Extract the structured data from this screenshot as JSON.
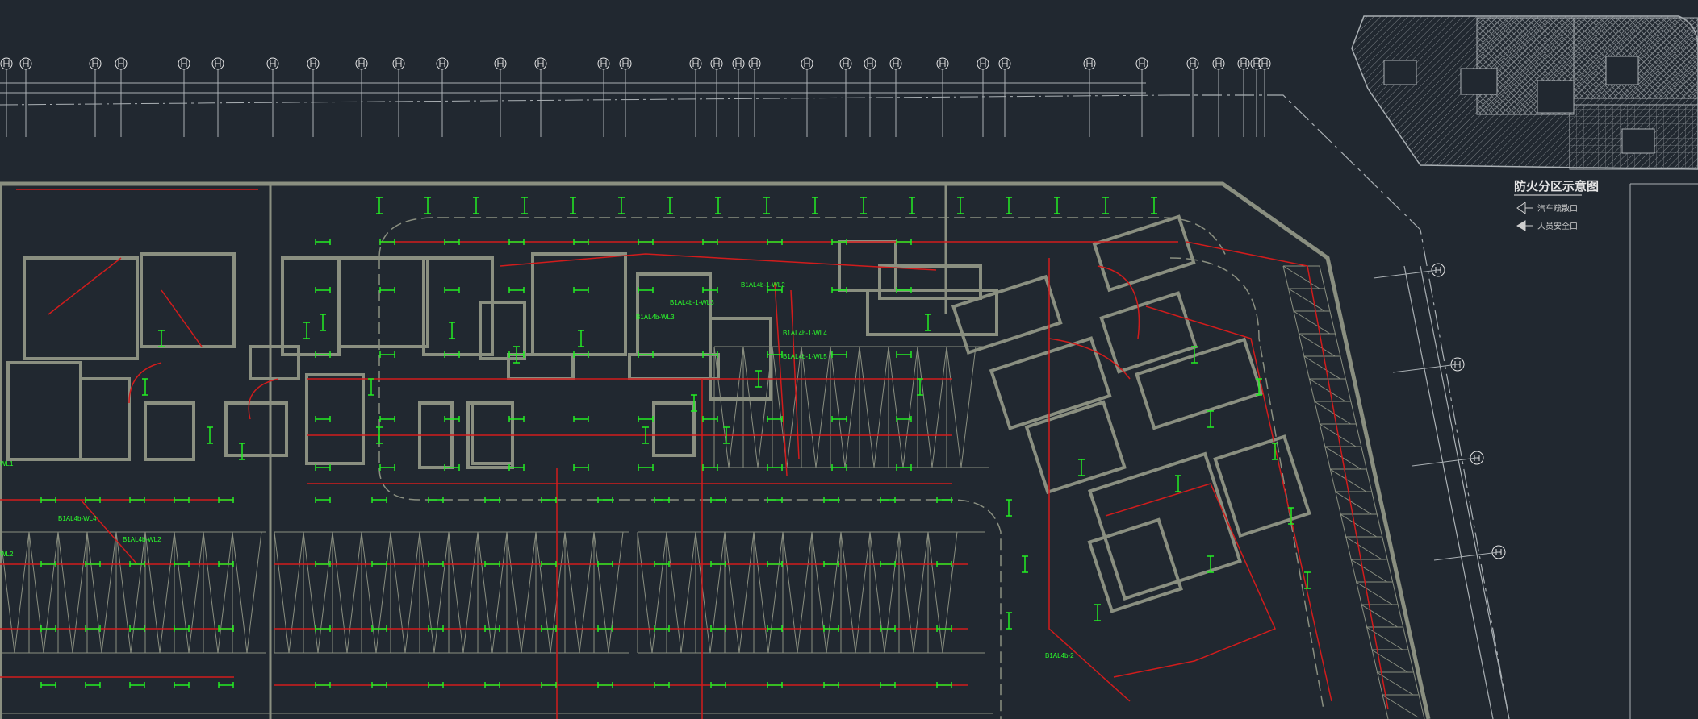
{
  "legend": {
    "title": "防火分区示意图",
    "items": [
      {
        "label": "汽车疏散口",
        "icon": "arrow-outline-left-icon"
      },
      {
        "label": "人员安全口",
        "icon": "arrow-solid-left-icon"
      }
    ]
  },
  "circuit_labels": [
    "B1AL4b-1-WL2",
    "B1AL4b-1-WL3",
    "B1AL4b-1-WL4",
    "B1AL4b-1-WL5",
    "B1AL4b-WL3",
    "B1AL4b-WL4",
    "B1AL4b-WL2",
    "WL1",
    "WL2",
    "B1AL4b-2"
  ],
  "colors": {
    "background": "#212830",
    "wall": "#8a8f80",
    "red_wiring": "#d21c1c",
    "green_fixture": "#22ee22",
    "grey_line": "#aab0b4"
  }
}
